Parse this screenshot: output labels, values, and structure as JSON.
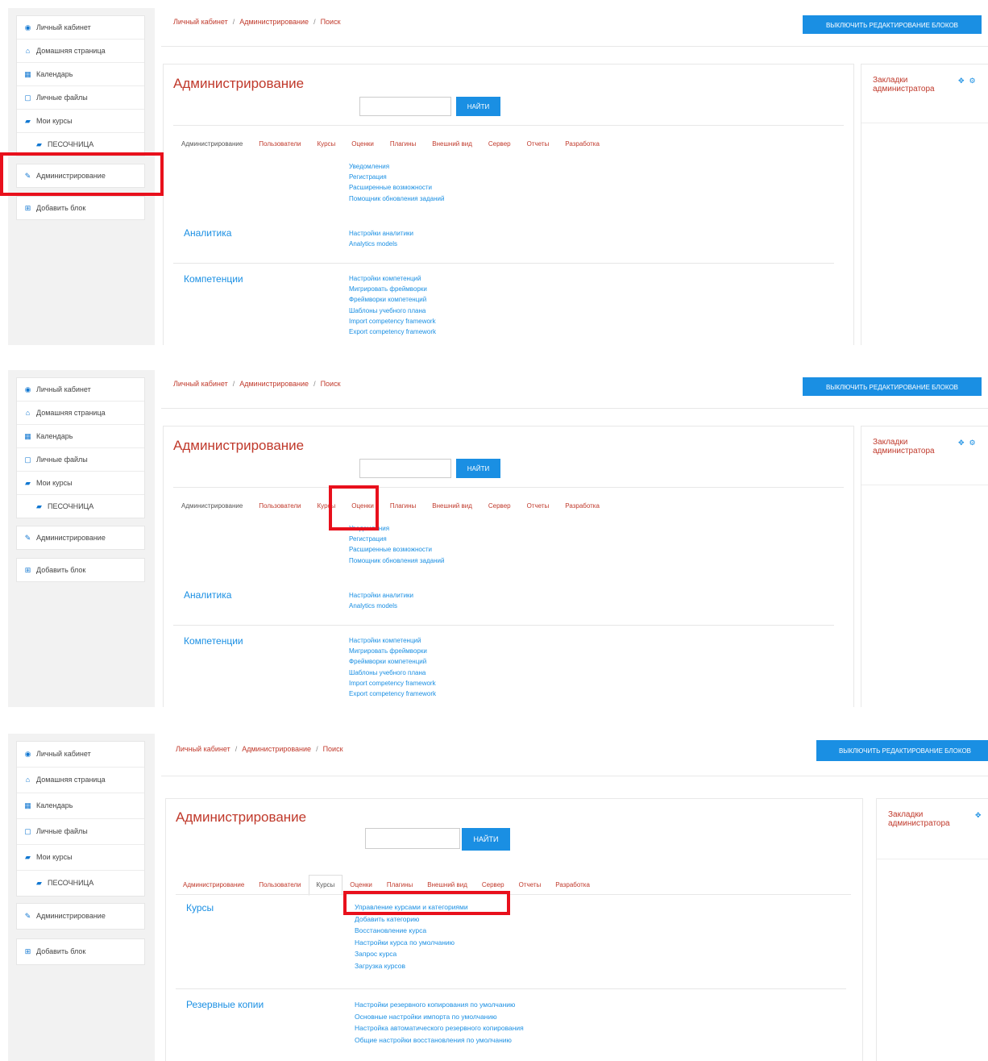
{
  "sidebar": {
    "items": [
      {
        "icon": "dashboard-icon",
        "glyph": "◉",
        "label": "Личный кабинет"
      },
      {
        "icon": "home-icon",
        "glyph": "⌂",
        "label": "Домашняя страница"
      },
      {
        "icon": "calendar-icon",
        "glyph": "▦",
        "label": "Календарь"
      },
      {
        "icon": "file-icon",
        "glyph": "▢",
        "label": "Личные файлы"
      },
      {
        "icon": "graduation-cap-icon",
        "glyph": "▰",
        "label": "Мои курсы"
      },
      {
        "icon": "graduation-cap-icon",
        "glyph": "▰",
        "label": "ПЕСОЧНИЦА"
      }
    ],
    "admin": {
      "icon": "wrench-icon",
      "glyph": "✎",
      "label": "Администрирование"
    },
    "add_block": {
      "icon": "plus-square-icon",
      "glyph": "⊞",
      "label": "Добавить блок"
    }
  },
  "breadcrumb": [
    "Личный кабинет",
    "Администрирование",
    "Поиск"
  ],
  "edit_button": "ВЫКЛЮЧИТЬ РЕДАКТИРОВАНИЕ БЛОКОВ",
  "page_title": "Администрирование",
  "search_button": "НАЙТИ",
  "tabs": [
    "Администрирование",
    "Пользователи",
    "Курсы",
    "Оценки",
    "Плагины",
    "Внешний вид",
    "Сервер",
    "Отчеты",
    "Разработка"
  ],
  "side_block": {
    "title": "Закладки администратора"
  },
  "general_links": [
    "Уведомления",
    "Регистрация",
    "Расширенные возможности",
    "Помощник обновления заданий"
  ],
  "analytics": {
    "title": "Аналитика",
    "links": [
      "Настройки аналитики",
      "Analytics models"
    ]
  },
  "competencies": {
    "title": "Компетенции",
    "links": [
      "Настройки компетенций",
      "Мигрировать фреймворки",
      "Фреймворки компетенций",
      "Шаблоны учебного плана",
      "Import competency framework",
      "Export competency framework"
    ]
  },
  "courses": {
    "title": "Курсы",
    "links": [
      "Управление курсами и категориями",
      "Добавить категорию",
      "Восстановление курса",
      "Настройки курса по умолчанию",
      "Запрос курса",
      "Загрузка курсов"
    ]
  },
  "backups": {
    "title": "Резервные копии",
    "links": [
      "Настройки резервного копирования по умолчанию",
      "Основные настройки импорта по умолчанию",
      "Настройка автоматического резервного копирования",
      "Общие настройки восстановления по умолчанию"
    ]
  },
  "colors": {
    "accent": "#1a8fe3",
    "title": "#c0392b",
    "highlight": "#e8101c"
  }
}
